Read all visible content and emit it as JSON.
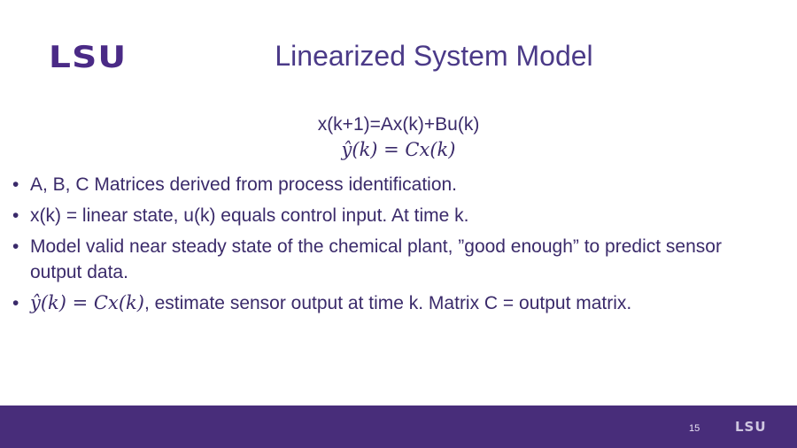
{
  "logo": {
    "text": "LSU"
  },
  "slide": {
    "title": "Linearized System Model",
    "equations": {
      "state_equation": "x(k+1)=Ax(k)+Bu(k)",
      "output_equation": "ŷ(k) = Cx(k)"
    },
    "bullet_glyph": "•",
    "bullets": [
      {
        "prefix": "",
        "text": "A, B, C Matrices derived from process identification."
      },
      {
        "prefix": "",
        "text": "x(k) = linear state, u(k) equals control input. At time k."
      },
      {
        "prefix": "",
        "text": "Model valid near steady state of the chemical plant, ”good enough” to predict sensor output data."
      },
      {
        "prefix": "ŷ(k) = Cx(k)",
        "text": ", estimate sensor output at time k. Matrix C = output matrix."
      }
    ]
  },
  "footer": {
    "page_number": "15",
    "logo_text": "LSU"
  },
  "colors": {
    "brand_purple": "#482d7a",
    "title_color": "#4b3a88",
    "text_color": "#3a2a6a"
  }
}
